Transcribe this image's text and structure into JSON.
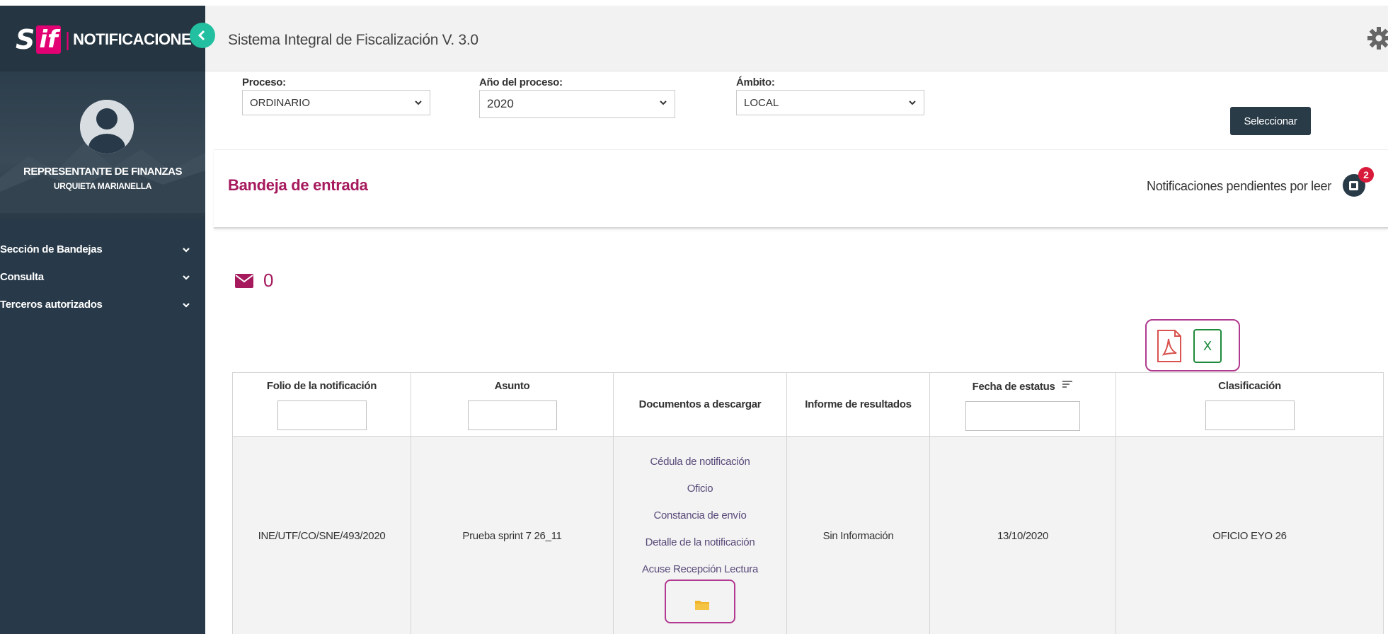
{
  "brand": {
    "logo_s": "S",
    "logo_if": "if",
    "separator": "|",
    "title": "NOTIFICACIONES"
  },
  "header": {
    "app_title": "Sistema Integral de Fiscalización V. 3.0"
  },
  "user": {
    "role": "REPRESENTANTE DE FINANZAS",
    "name": "URQUIETA MARIANELLA"
  },
  "sidebar": {
    "items": [
      {
        "label": "Sección de Bandejas"
      },
      {
        "label": "Consulta"
      },
      {
        "label": "Terceros autorizados"
      }
    ]
  },
  "filters": {
    "proceso": {
      "label": "Proceso:",
      "value": "ORDINARIO"
    },
    "anio": {
      "label": "Año del proceso:",
      "value": "2020"
    },
    "ambito": {
      "label": "Ámbito:",
      "value": "LOCAL"
    },
    "submit_label": "Seleccionar"
  },
  "inbox": {
    "title": "Bandeja de entrada",
    "pending_label": "Notificaciones pendientes por leer",
    "pending_count": "2",
    "mail_count": "0"
  },
  "export": {
    "excel_label": "X"
  },
  "table": {
    "columns": [
      "Folio de la notificación",
      "Asunto",
      "Documentos a descargar",
      "Informe de resultados",
      "Fecha de estatus",
      "Clasificación"
    ],
    "rows": [
      {
        "folio": "INE/UTF/CO/SNE/493/2020",
        "asunto": "Prueba sprint 7 26_11",
        "documentos": [
          "Cédula de notificación",
          "Oficio",
          "Constancia de envío",
          "Detalle de la notificación",
          "Acuse Recepción Lectura"
        ],
        "informe": "Sin Información",
        "fecha": "13/10/2020",
        "clasificacion": "OFICIO EYO 26"
      }
    ]
  },
  "colors": {
    "sidebar_bg": "#283a49",
    "accent_magenta": "#a6195d",
    "collapse_green": "#22c0a0",
    "button_dark": "#2a3b48",
    "badge_red": "#d81b3a"
  }
}
